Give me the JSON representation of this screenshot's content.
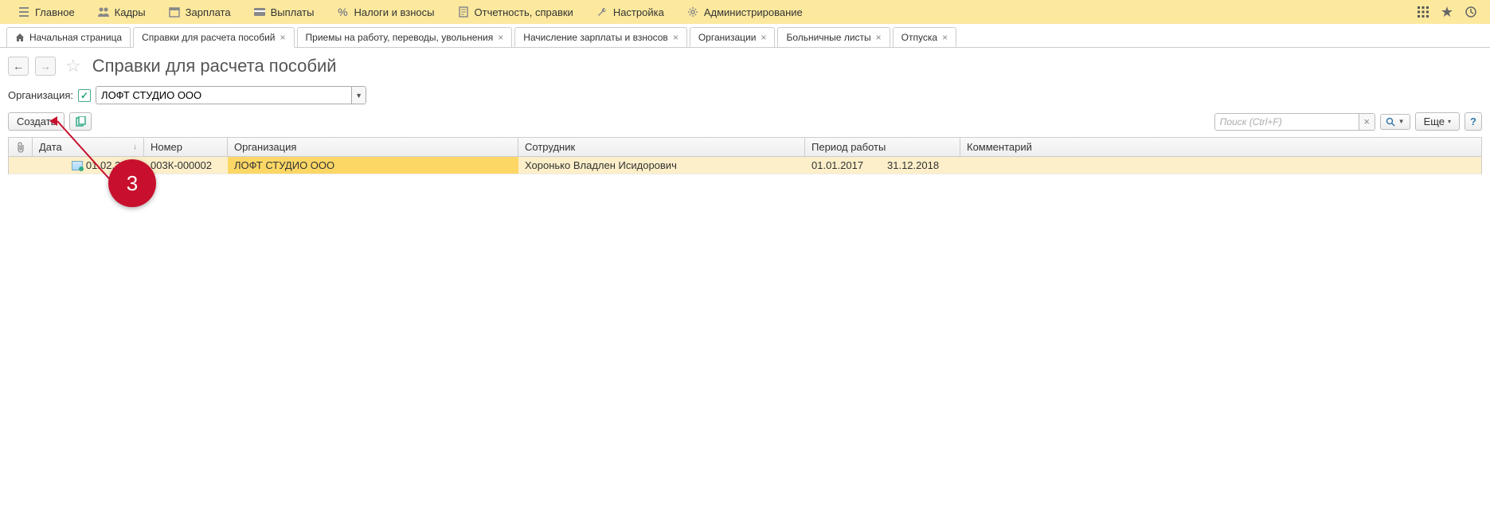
{
  "topmenu": [
    {
      "icon": "menu",
      "label": "Главное"
    },
    {
      "icon": "people",
      "label": "Кадры"
    },
    {
      "icon": "calendar",
      "label": "Зарплата"
    },
    {
      "icon": "wallet",
      "label": "Выплаты"
    },
    {
      "icon": "percent",
      "label": "Налоги и взносы"
    },
    {
      "icon": "doc",
      "label": "Отчетность, справки"
    },
    {
      "icon": "wrench",
      "label": "Настройка"
    },
    {
      "icon": "gear",
      "label": "Администрирование"
    }
  ],
  "tabs": [
    {
      "label": "Начальная страница",
      "home": true,
      "closable": false,
      "active": false
    },
    {
      "label": "Справки для расчета пособий",
      "closable": true,
      "active": true
    },
    {
      "label": "Приемы на работу, переводы, увольнения",
      "closable": true,
      "active": false
    },
    {
      "label": "Начисление зарплаты и взносов",
      "closable": true,
      "active": false
    },
    {
      "label": "Организации",
      "closable": true,
      "active": false
    },
    {
      "label": "Больничные листы",
      "closable": true,
      "active": false
    },
    {
      "label": "Отпуска",
      "closable": true,
      "active": false
    }
  ],
  "page_title": "Справки для расчета пособий",
  "filter": {
    "label": "Организация:",
    "checked": true,
    "value": "ЛОФТ СТУДИО ООО"
  },
  "toolbar": {
    "create": "Создать",
    "search_placeholder": "Поиск (Ctrl+F)",
    "more": "Еще"
  },
  "columns": {
    "date": "Дата",
    "number": "Номер",
    "org": "Организация",
    "employee": "Сотрудник",
    "period": "Период работы",
    "comment": "Комментарий"
  },
  "rows": [
    {
      "date": "01.02.2019",
      "number": "003К-000002",
      "org": "ЛОФТ СТУДИО ООО",
      "employee": "Хоронько Владлен Исидорович",
      "period_from": "01.01.2017",
      "period_to": "31.12.2018",
      "comment": ""
    }
  ],
  "annotation": {
    "num": "3"
  }
}
